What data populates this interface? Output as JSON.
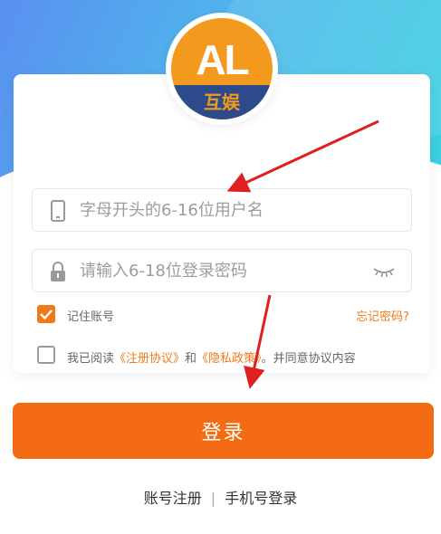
{
  "logo": {
    "mark": "AL",
    "subtitle": "互娱"
  },
  "form": {
    "username_placeholder": "字母开头的6-16位用户名",
    "password_placeholder": "请输入6-18位登录密码"
  },
  "remember": {
    "label": "记住账号",
    "checked": true
  },
  "forgot_label": "忘记密码?",
  "agreement": {
    "prefix": "我已阅读",
    "terms": "《注册协议》",
    "and": "和",
    "privacy": "《隐私政策》",
    "suffix": "。并同意协议内容",
    "checked": false
  },
  "login_label": "登录",
  "links": {
    "register": "账号注册",
    "separator": "|",
    "phone_login": "手机号登录"
  },
  "colors": {
    "accent": "#f36b12",
    "annotation_arrow": "#e02020"
  },
  "icons": [
    "phone-icon",
    "lock-icon",
    "eye-closed-icon",
    "check-icon"
  ]
}
